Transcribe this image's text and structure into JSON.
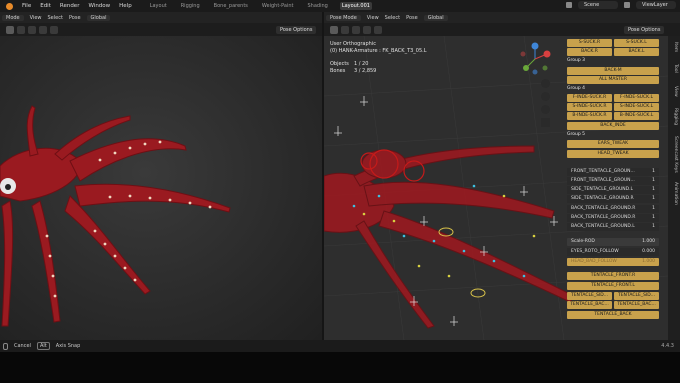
{
  "topbar": {
    "menu": [
      "File",
      "Edit",
      "Render",
      "Window",
      "Help"
    ],
    "workspaces": [
      "Layout",
      "Rigging",
      "Bone_parents",
      "Weight-Paint",
      "Shading",
      "Layout.001"
    ],
    "active_workspace": "Layout.001",
    "scene": "Scene",
    "view_layer": "ViewLayer"
  },
  "left_view": {
    "header": {
      "mode": "Mode",
      "items": [
        "View",
        "Select",
        "Pose"
      ],
      "orientation": "Global"
    },
    "pose_options": "Pose Options"
  },
  "right_view": {
    "header": {
      "mode": "Pose Mode",
      "items": [
        "View",
        "Select",
        "Pose"
      ],
      "orientation": "Global"
    },
    "pose_options": "Pose Options",
    "overlay": {
      "view_name": "User Orthographic",
      "object_name": "(0) HANK-Armature : FK_BACK_T3_05.L",
      "objects_label": "Objects",
      "objects_value": "1 / 20",
      "bones_label": "Bones",
      "bones_value": "3 / 2,859"
    }
  },
  "panel": {
    "row1": [
      "S-SUCK.R",
      "S-SUCK.L"
    ],
    "row2": [
      "BACK.R",
      "BACK.L"
    ],
    "group3": "Group 3",
    "back_m": "BACK-M",
    "all_master": "ALL MASTER",
    "group4": "Group 4",
    "row4a": [
      "F-INDE-SUCK.R",
      "F-INDE-SUCK.L"
    ],
    "row4b": [
      "S-INDE-SUCK.R",
      "S-INDE-SUCK.L"
    ],
    "row4c": [
      "B-INDE-SUCK.R",
      "B-INDE-SUCK.L"
    ],
    "back_inde": "BACK_INDE",
    "group5": "Group 5",
    "ears_tweak": "EARS_TWEAK",
    "head_tweak": "HEAD_TWEAK",
    "props": [
      {
        "name": "FRONT_TENTACLE_GROUN...",
        "value": "1"
      },
      {
        "name": "FRONT_TENTACLE_GROUN...",
        "value": "1"
      },
      {
        "name": "SIDE_TENTACLE_GROUND.L",
        "value": "1"
      },
      {
        "name": "SIDE_TENTACLE_GROUND.R",
        "value": "1"
      },
      {
        "name": "BACK_TENTACLE_GROUND.R",
        "value": "1"
      },
      {
        "name": "BACK_TENTACLE_GROUND.R",
        "value": "1"
      },
      {
        "name": "BACK_TENTACLE_GROUND.L",
        "value": "1"
      }
    ],
    "sliders": [
      {
        "name": "Scale-ROD",
        "value": "1.000"
      },
      {
        "name": "EYES_ROTO_FOLLOW",
        "value": "0.000"
      },
      {
        "name": "HEAD_BAD_FOLLOW",
        "value": "1.000"
      }
    ],
    "tent_front_r": "TENTACLE_FRONT.R",
    "tent_front_l": "TENTACLE_FRONT.L",
    "tent_sid": [
      "TENTACLE_SID...",
      "TENTACLE_SID..."
    ],
    "tent_bac": [
      "TENTACLE_BAC...",
      "TENTACLE_BAC..."
    ],
    "tent_back": "TENTACLE_BACK"
  },
  "side_tabs": [
    "Item",
    "Tool",
    "View",
    "Rigging",
    "Screencast Keys",
    "Animation"
  ],
  "status": {
    "cancel_label": "Cancel",
    "alt_key": "Alt",
    "axis_snap": "Axis Snap",
    "version": "4.4.3"
  },
  "colors": {
    "accent_button": "#c8a14c",
    "tentacle_red": "#9a1a20",
    "background": "#2e2e2e"
  }
}
